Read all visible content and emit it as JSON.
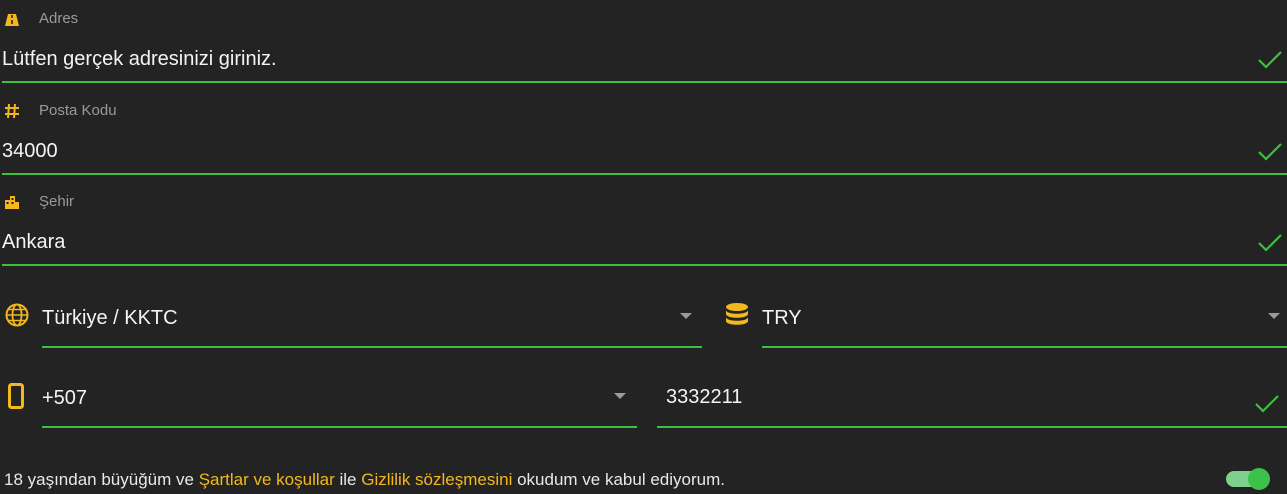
{
  "colors": {
    "accent": "#f5b81c",
    "success": "#3fbf3f",
    "label": "#9a9a9a",
    "background": "#232323"
  },
  "address": {
    "label": "Adres",
    "value": "Lütfen gerçek adresinizi giriniz.",
    "icon": "road-icon"
  },
  "postal": {
    "label": "Posta Kodu",
    "value": "34000",
    "icon": "hash-icon"
  },
  "city": {
    "label": "Şehir",
    "value": "Ankara",
    "icon": "city-icon"
  },
  "country": {
    "value": "Türkiye / KKTC",
    "icon": "globe-icon"
  },
  "currency": {
    "value": "TRY",
    "icon": "coins-icon"
  },
  "phone": {
    "code": "+507",
    "number": "3332211",
    "icon": "mobile-icon"
  },
  "terms": {
    "prefix": "18 yaşından büyüğüm ve ",
    "link1": "Şartlar ve koşullar",
    "middle": " ile ",
    "link2": "Gizlilik sözleşmesini",
    "suffix": " okudum ve kabul ediyorum.",
    "toggle_on": true
  }
}
